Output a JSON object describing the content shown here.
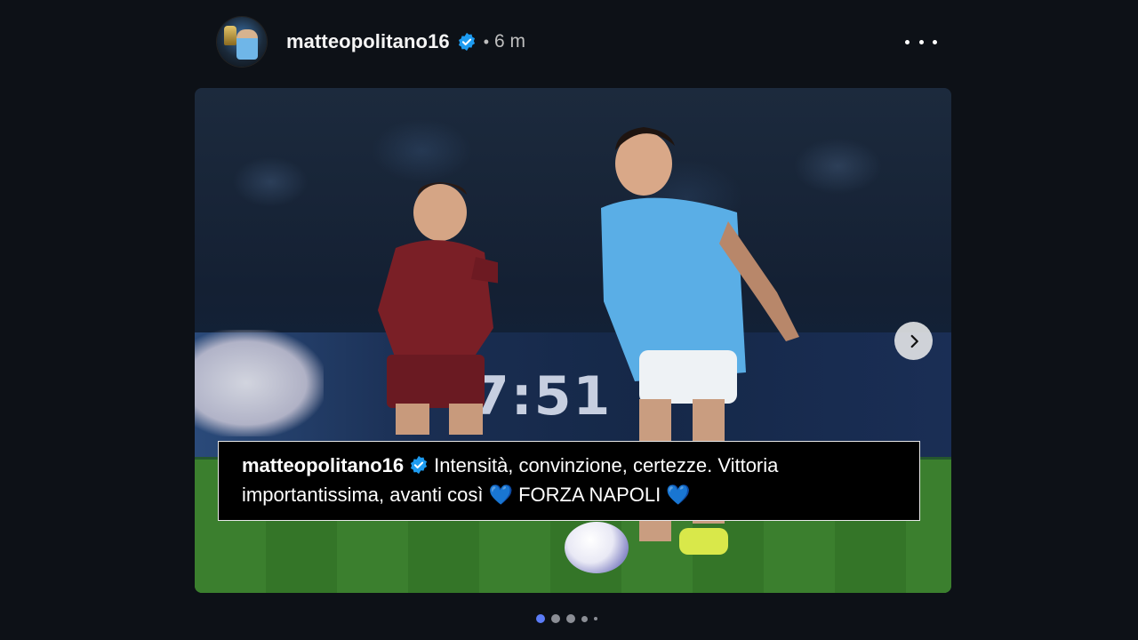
{
  "post": {
    "username": "matteopolitano16",
    "separator": "•",
    "time_ago": "6 m",
    "clock_on_board": "7:51",
    "caption": {
      "username": "matteopolitano16",
      "text_line1": "Intensità, convinzione, certezze. Vittoria",
      "text_line2_a": "importantissima, avanti così",
      "text_line2_b": "FORZA NAPOLI",
      "heart": "💙"
    },
    "carousel": {
      "page_count": 5,
      "active_index": 0
    }
  },
  "icons": {
    "verified": "verified-badge-icon",
    "more": "more-options-icon",
    "next": "chevron-right-icon"
  },
  "colors": {
    "background": "#0d1117",
    "verified_blue": "#1d9bf0",
    "active_dot": "#5b7cf7",
    "heart_blue": "#1f7ef0"
  }
}
